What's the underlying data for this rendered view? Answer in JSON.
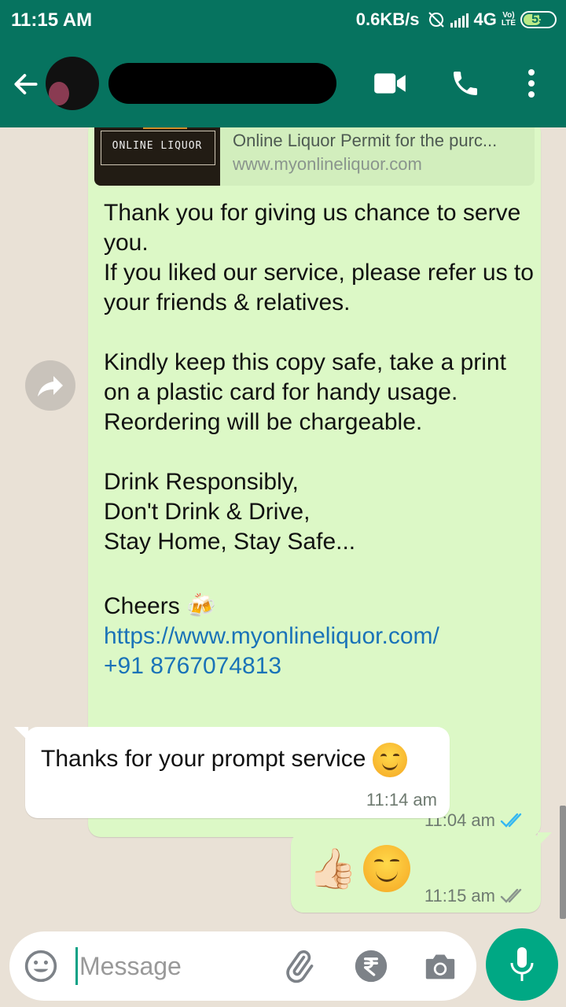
{
  "status_bar": {
    "time": "11:15 AM",
    "network_speed": "0.6KB/s",
    "network_type": "4G",
    "volte_top": "Vo)",
    "volte_bottom": "LTE",
    "battery": "55"
  },
  "header": {
    "back_icon": "arrow-left-icon",
    "video_icon": "videocam-icon",
    "call_icon": "phone-icon",
    "more_icon": "more-vert-icon",
    "header_color": "#06735f"
  },
  "messages": {
    "m1": {
      "link_preview": {
        "thumbnail_brand": "ONLINE LIQUOR",
        "title": "Online Liquor Permit for the purc...",
        "url": "www.myonlineliquor.com"
      },
      "line1": "Thank you for giving us chance to serve you.",
      "line2": "If you liked our service, please refer us to your friends & relatives.",
      "line3": "Kindly keep this copy safe, take a print on a plastic card for handy usage. Reordering will be chargeable.",
      "line4": "Drink Responsibly,",
      "line5": "Don't Drink & Drive,",
      "line6": "Stay Home, Stay Safe...",
      "cheers": "Cheers",
      "beer_emoji": "🍻",
      "link": "https://www.myonlineliquor.com/",
      "phone": "+91 8767074813",
      "time": "11:04 am",
      "read_color": "#34b7f1"
    },
    "m2": {
      "text": "Thanks for your prompt service",
      "emoji": "smiling-face-emoji",
      "time": "11:14 am"
    },
    "m3": {
      "thumb_emoji": "👍🏻",
      "time": "11:15 am",
      "delivered_color": "#8a958d"
    }
  },
  "composer": {
    "placeholder": "Message",
    "mic_color": "#00a884"
  }
}
